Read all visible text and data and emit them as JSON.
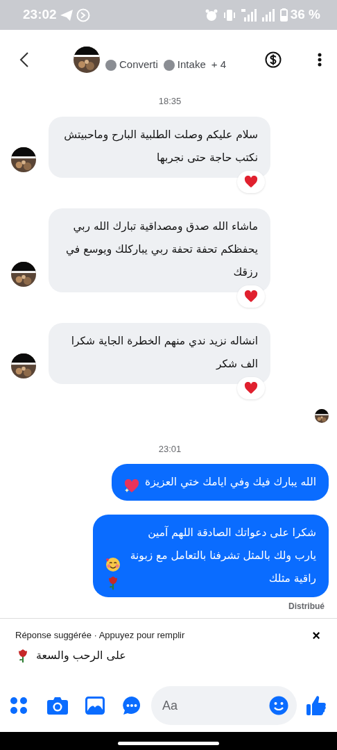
{
  "status_bar": {
    "time": "23:02",
    "battery": "36 %"
  },
  "header": {
    "tag_1": "Converti",
    "tag_2": "Intake",
    "more_labels": "+ 4"
  },
  "messages": [
    {
      "kind": "timestamp",
      "text": "18:35"
    },
    {
      "kind": "received",
      "text": "سلام عليكم وصلت الطلبية البارح وماحبيتش نكتب حاجة حتى نجربها",
      "reacted": true
    },
    {
      "kind": "received",
      "text": "ماشاء الله صدق ومصداقية تبارك الله ربي يحفظكم تحفة تحفة ربي يباركلك ويوسع  في رزقك",
      "reacted": true
    },
    {
      "kind": "received",
      "text": "انشاله نزيد ندي منهم الخطرة الجاية شكرا الف شكر",
      "reacted": true
    },
    {
      "kind": "seen"
    },
    {
      "kind": "timestamp",
      "text": "23:01"
    },
    {
      "kind": "sent",
      "text": "الله يبارك فيك وفي ايامك ختي العزيزة",
      "emoji": [
        {
          "kind": "sparkling-heart"
        }
      ]
    },
    {
      "kind": "sent",
      "text": "شكرا على دعواتك الصادقة اللهم آمين يارب ولك بالمثل تشرفنا بالتعامل مع زبونة راقية مثلك",
      "emoji": [
        {
          "kind": "smiling-face"
        },
        {
          "kind": "rose"
        }
      ]
    },
    {
      "kind": "status",
      "text": "Distribué"
    }
  ],
  "suggestion": {
    "title": "Réponse suggérée",
    "separator": "·",
    "hint": "Appuyez pour remplir",
    "close": "×",
    "text": "على الرحب والسعة",
    "emoji": [
      {
        "kind": "rose"
      }
    ]
  },
  "composer": {
    "placeholder": "Aa"
  }
}
